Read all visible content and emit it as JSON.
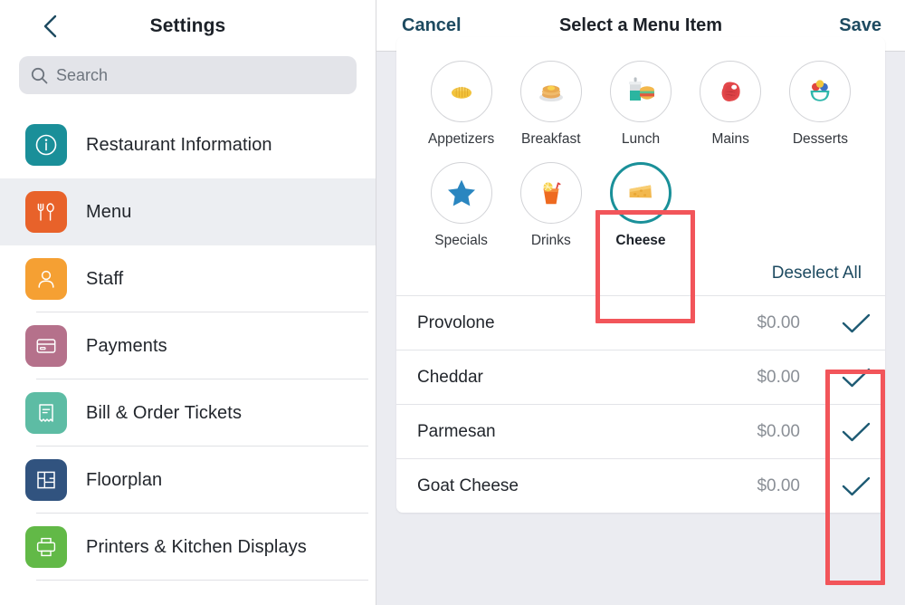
{
  "sidebar": {
    "title": "Settings",
    "back_icon": "back-chevron-icon",
    "search": {
      "placeholder": "Search",
      "value": "",
      "icon": "search-icon"
    },
    "items": [
      {
        "label": "Restaurant Information",
        "icon": "info-circle-icon",
        "color": "#1a8f99",
        "selected": false
      },
      {
        "label": "Menu",
        "icon": "fork-spoon-icon",
        "color": "#e8622a",
        "selected": true
      },
      {
        "label": "Staff",
        "icon": "person-icon",
        "color": "#f5a033",
        "selected": false
      },
      {
        "label": "Payments",
        "icon": "credit-card-icon",
        "color": "#b5718b",
        "selected": false
      },
      {
        "label": "Bill & Order Tickets",
        "icon": "receipt-icon",
        "color": "#5dbca4",
        "selected": false
      },
      {
        "label": "Floorplan",
        "icon": "floorplan-icon",
        "color": "#31537f",
        "selected": false
      },
      {
        "label": "Printers & Kitchen Displays",
        "icon": "printer-icon",
        "color": "#62b947",
        "selected": false
      }
    ]
  },
  "panel": {
    "cancel_label": "Cancel",
    "title": "Select a Menu Item",
    "save_label": "Save",
    "deselect_all_label": "Deselect All",
    "categories": [
      {
        "label": "Appetizers",
        "icon": "bread-icon",
        "selected": false
      },
      {
        "label": "Breakfast",
        "icon": "pancakes-icon",
        "selected": false
      },
      {
        "label": "Lunch",
        "icon": "burger-drink-icon",
        "selected": false
      },
      {
        "label": "Mains",
        "icon": "steak-icon",
        "selected": false
      },
      {
        "label": "Desserts",
        "icon": "ice-cream-icon",
        "selected": false
      },
      {
        "label": "Specials",
        "icon": "star-icon",
        "selected": false
      },
      {
        "label": "Drinks",
        "icon": "juice-glass-icon",
        "selected": false
      },
      {
        "label": "Cheese",
        "icon": "cheese-wedge-icon",
        "selected": true
      }
    ],
    "items": [
      {
        "name": "Provolone",
        "price": "$0.00",
        "checked": true
      },
      {
        "name": "Cheddar",
        "price": "$0.00",
        "checked": true
      },
      {
        "name": "Parmesan",
        "price": "$0.00",
        "checked": true
      },
      {
        "name": "Goat Cheese",
        "price": "$0.00",
        "checked": true
      }
    ]
  },
  "annotations": {
    "color": "#f2555a",
    "boxes": [
      {
        "name": "cheese-category-highlight"
      },
      {
        "name": "checkmark-column-highlight"
      }
    ]
  }
}
